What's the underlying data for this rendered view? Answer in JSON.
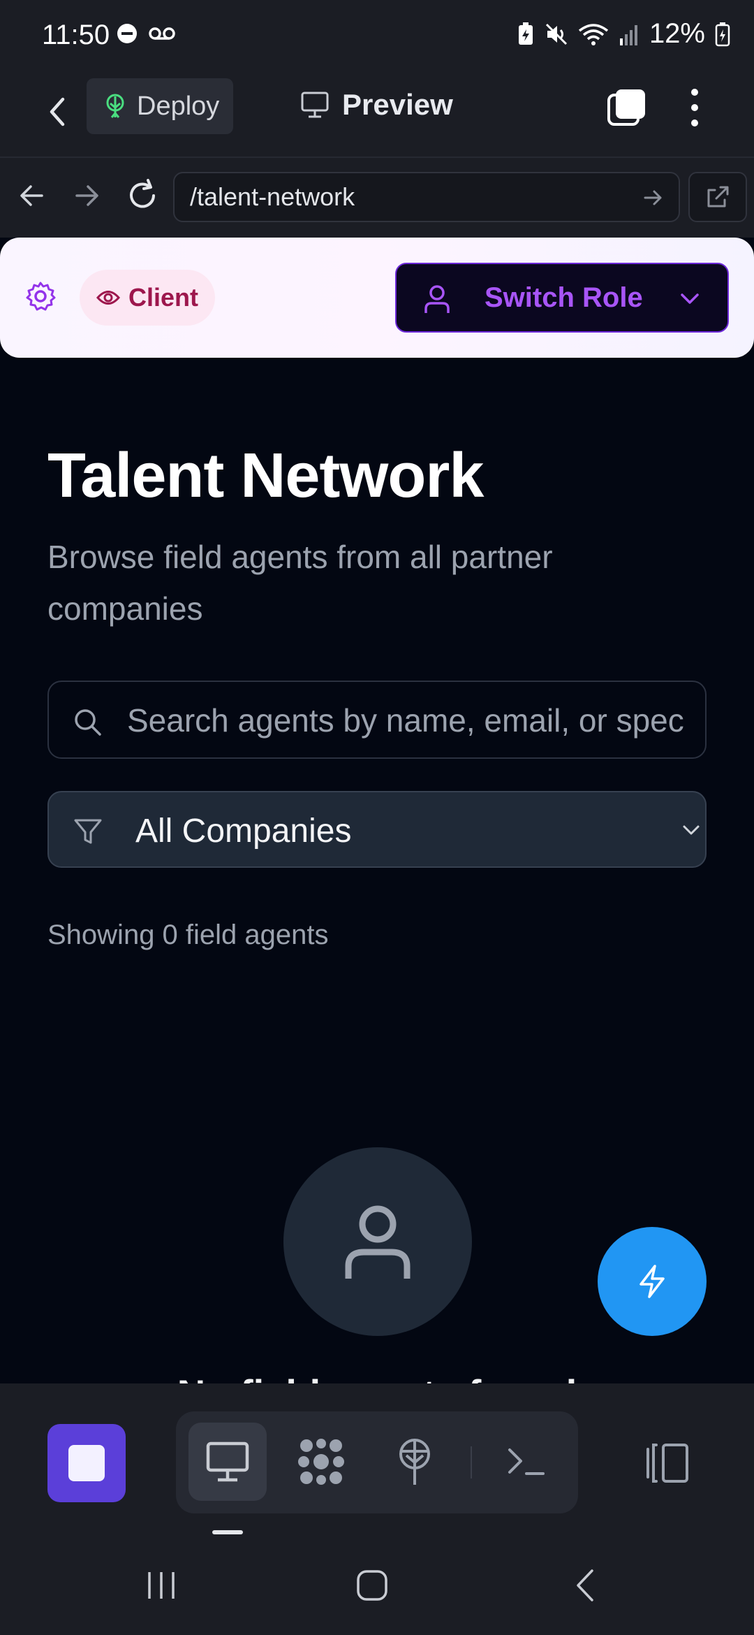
{
  "status_bar": {
    "time": "11:50",
    "battery": "12%"
  },
  "app_bar": {
    "deploy_label": "Deploy",
    "preview_label": "Preview"
  },
  "url_bar": {
    "url": "/talent-network"
  },
  "role_header": {
    "role_badge": "Client",
    "switch_role_label": "Switch Role"
  },
  "main": {
    "title": "Talent Network",
    "subtitle": "Browse field agents from all partner companies",
    "search_placeholder": "Search agents by name, email, or specialty",
    "company_filter_value": "All Companies",
    "showing_text": "Showing 0 field agents",
    "empty_state_title": "No field agents found"
  },
  "colors": {
    "background": "#030712",
    "accent_purple": "#a855f7",
    "client_badge_bg": "#fce7f3",
    "client_badge_text": "#9d174d",
    "fab": "#2196f3",
    "stop_button": "#5b3fd9"
  },
  "icons": {
    "deploy": "deploy-tree-icon",
    "preview": "monitor-icon",
    "settings": "gear-icon",
    "client": "eye-icon",
    "switch_role": "person-icon",
    "search": "search-icon",
    "filter": "filter-icon",
    "empty_state": "person-icon",
    "fab": "lightning-icon"
  }
}
